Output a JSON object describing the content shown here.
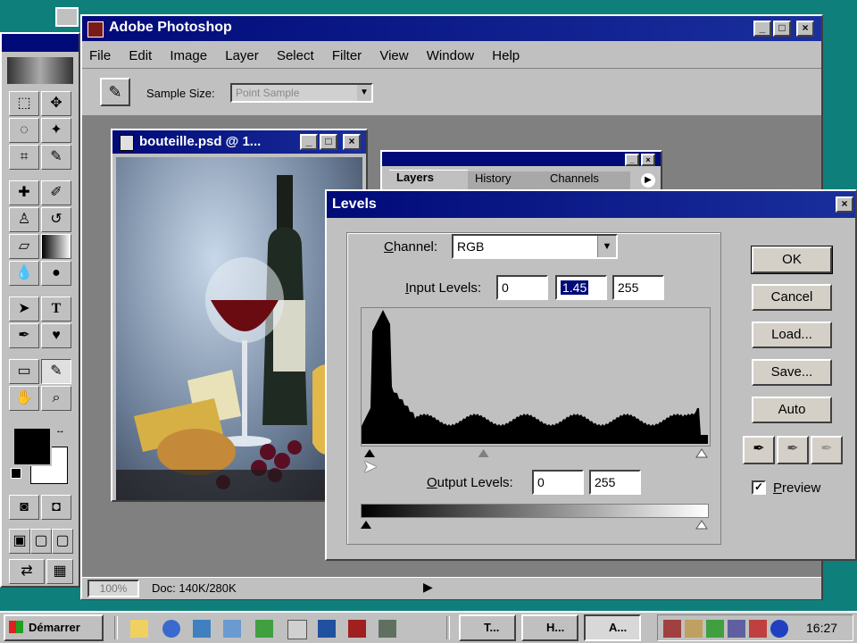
{
  "app": {
    "title": "Adobe Photoshop"
  },
  "menu": [
    "File",
    "Edit",
    "Image",
    "Layer",
    "Select",
    "Filter",
    "View",
    "Window",
    "Help"
  ],
  "options_bar": {
    "sample_size_label": "Sample Size:",
    "sample_size_value": "Point Sample"
  },
  "document": {
    "title": "bouteille.psd @ 1..."
  },
  "palette": {
    "tabs": [
      "Layers",
      "History",
      "Channels"
    ]
  },
  "levels": {
    "title": "Levels",
    "channel_label": "Channel:",
    "channel_value": "RGB",
    "input_label": "Input Levels:",
    "input_values": [
      "0",
      "1.45",
      "255"
    ],
    "output_label": "Output Levels:",
    "output_values": [
      "0",
      "255"
    ],
    "buttons": [
      "OK",
      "Cancel",
      "Load...",
      "Save...",
      "Auto"
    ],
    "preview_label": "Preview",
    "preview_checked": true,
    "gamma_position": 0.35
  },
  "statusbar": {
    "zoom": "100%",
    "doc": "Doc: 140K/280K"
  },
  "taskbar": {
    "start": "Démarrer",
    "tasks": [
      "T...",
      "H...",
      "A..."
    ],
    "clock": "16:27"
  },
  "colors": {
    "titlebar": "#000a78",
    "desktop": "#0f7f7c",
    "chrome": "#c0c0c0"
  }
}
